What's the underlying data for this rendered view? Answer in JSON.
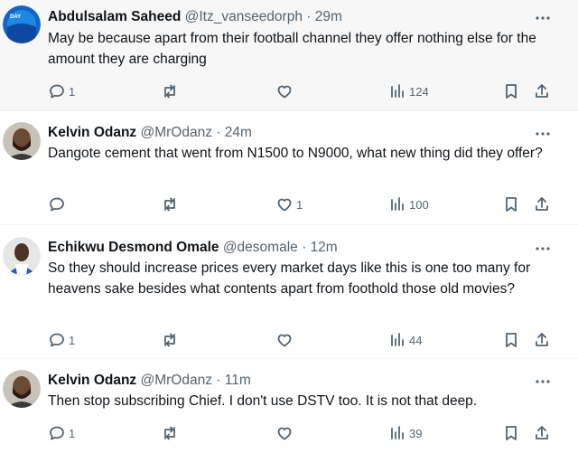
{
  "tweets": [
    {
      "name": "Abdulsalam Saheed",
      "handle": "@Itz_vanseedorph",
      "sep": "·",
      "time": "29m",
      "text": "May be because apart from their football channel they offer nothing else for the amount they are charging",
      "replies": "1",
      "reposts": "",
      "likes": "",
      "views": "124"
    },
    {
      "name": "Kelvin Odanz",
      "handle": "@MrOdanz",
      "sep": "·",
      "time": "24m",
      "text": "Dangote cement that went from N1500 to N9000, what new thing did they offer?",
      "replies": "",
      "reposts": "",
      "likes": "1",
      "views": "100"
    },
    {
      "name": "Echikwu Desmond Omale",
      "handle": "@desomale",
      "sep": "·",
      "time": "12m",
      "text": "So they should increase prices every market days like this is one too many for heavens sake besides what contents apart from foothold those old movies?",
      "replies": "1",
      "reposts": "",
      "likes": "",
      "views": "44"
    },
    {
      "name": "Kelvin Odanz",
      "handle": "@MrOdanz",
      "sep": "·",
      "time": "11m",
      "text": "Then stop subscribing Chief. I don't use DSTV too. It is not that deep.",
      "replies": "1",
      "reposts": "",
      "likes": "",
      "views": "39"
    }
  ],
  "avatar_logo_text": "DAY"
}
